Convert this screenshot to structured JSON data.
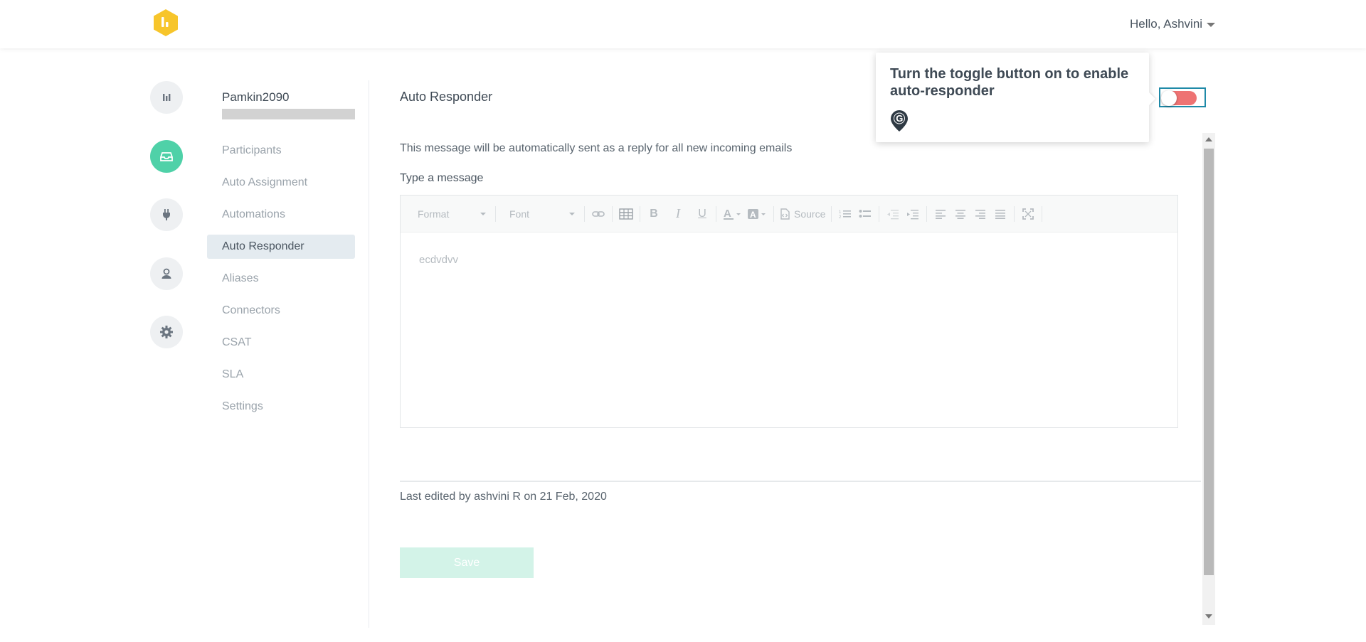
{
  "header": {
    "greeting": "Hello, Ashvini"
  },
  "rail": {
    "items": [
      {
        "icon": "analytics-icon",
        "active": false
      },
      {
        "icon": "inbox-icon",
        "active": true
      },
      {
        "icon": "plug-icon",
        "active": false
      },
      {
        "icon": "user-icon",
        "active": false
      },
      {
        "icon": "gear-icon",
        "active": false
      }
    ]
  },
  "subnav": {
    "account_name": "Pamkin2090",
    "items": [
      {
        "label": "Participants",
        "active": false
      },
      {
        "label": "Auto Assignment",
        "active": false
      },
      {
        "label": "Automations",
        "active": false
      },
      {
        "label": "Auto Responder",
        "active": true
      },
      {
        "label": "Aliases",
        "active": false
      },
      {
        "label": "Connectors",
        "active": false
      },
      {
        "label": "CSAT",
        "active": false
      },
      {
        "label": "SLA",
        "active": false
      },
      {
        "label": "Settings",
        "active": false
      }
    ]
  },
  "main": {
    "title": "Auto Responder",
    "description": "This message will be automatically sent as a reply for all new incoming emails",
    "type_label": "Type a message",
    "editor": {
      "format_label": "Format",
      "font_label": "Font",
      "source_label": "Source",
      "content": "ecdvdvv"
    },
    "last_edited": "Last edited by  ashvini R on 21 Feb, 2020",
    "save_label": "Save"
  },
  "toggle": {
    "state": "off",
    "track_color": "#ee7373"
  },
  "tooltip": {
    "text": "Turn the toggle button on to enable auto-responder"
  },
  "colors": {
    "accent": "#4fd1a8",
    "logo": "#f7c52b",
    "focus_ring": "#1f8aa8"
  }
}
